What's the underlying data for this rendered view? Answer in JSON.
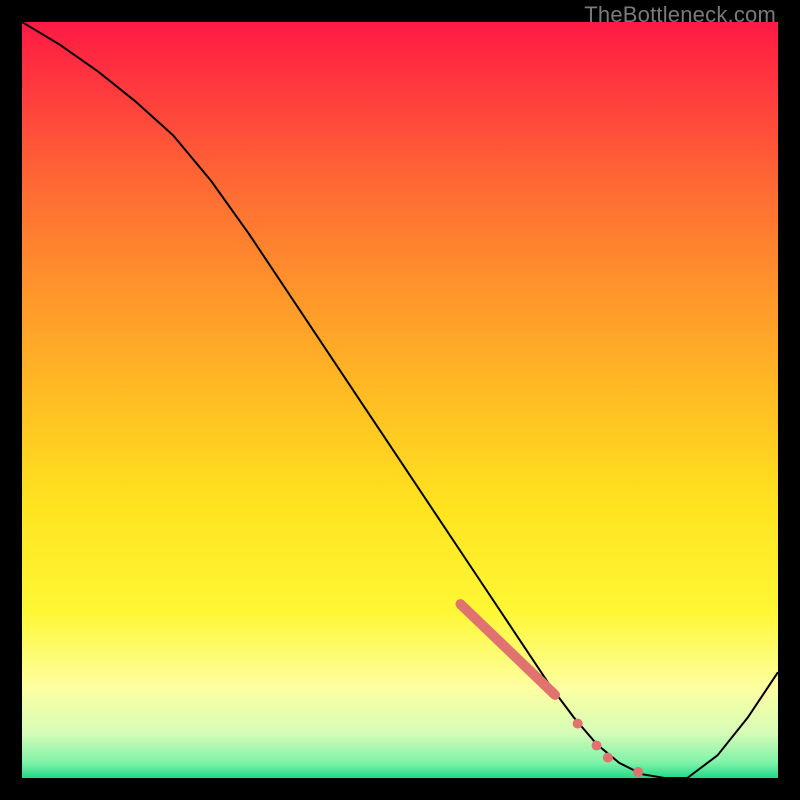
{
  "watermark": "TheBottleneck.com",
  "chart_data": {
    "type": "line",
    "title": "",
    "xlabel": "",
    "ylabel": "",
    "xlim": [
      0,
      100
    ],
    "ylim": [
      0,
      100
    ],
    "series": [
      {
        "name": "curve",
        "x": [
          0,
          5,
          10,
          15,
          20,
          25,
          30,
          35,
          40,
          45,
          50,
          55,
          60,
          65,
          70,
          73,
          76,
          79,
          82,
          85,
          88,
          92,
          96,
          100
        ],
        "y": [
          100,
          97,
          93.5,
          89.5,
          85,
          79,
          72,
          64.5,
          57,
          49.5,
          42,
          34.5,
          27,
          19.5,
          12,
          8,
          4.5,
          2,
          0.5,
          0,
          0,
          3,
          8,
          14
        ],
        "color": "#000000",
        "width": 2
      }
    ],
    "highlight_segment": {
      "x": [
        58,
        70.5
      ],
      "y": [
        23,
        11
      ],
      "color": "#e0736f",
      "width": 10
    },
    "highlight_dots": [
      {
        "x": 73.5,
        "y": 7.2,
        "r": 5,
        "color": "#e0736f"
      },
      {
        "x": 76.0,
        "y": 4.3,
        "r": 5,
        "color": "#e0736f"
      },
      {
        "x": 77.5,
        "y": 2.7,
        "r": 5,
        "color": "#e0736f"
      },
      {
        "x": 81.5,
        "y": 0.8,
        "r": 5,
        "color": "#e0736f"
      }
    ],
    "gradient_bands": [
      {
        "y0": 100,
        "y1": 91,
        "c0": "#ff1a44",
        "c1": "#ff3a3e"
      },
      {
        "y0": 91,
        "y1": 78,
        "c0": "#ff3a3e",
        "c1": "#ff6b33"
      },
      {
        "y0": 78,
        "y1": 64,
        "c0": "#ff6b33",
        "c1": "#ff962b"
      },
      {
        "y0": 64,
        "y1": 50,
        "c0": "#ff962b",
        "c1": "#ffbe23"
      },
      {
        "y0": 50,
        "y1": 36,
        "c0": "#ffbe23",
        "c1": "#ffe31f"
      },
      {
        "y0": 36,
        "y1": 22,
        "c0": "#ffe31f",
        "c1": "#fff735"
      },
      {
        "y0": 22,
        "y1": 12,
        "c0": "#fff735",
        "c1": "#fdffa0"
      },
      {
        "y0": 12,
        "y1": 6,
        "c0": "#fdffa0",
        "c1": "#d6fcb8"
      },
      {
        "y0": 6,
        "y1": 2,
        "c0": "#d6fcb8",
        "c1": "#7ef2a8"
      },
      {
        "y0": 2,
        "y1": 0,
        "c0": "#7ef2a8",
        "c1": "#22d888"
      }
    ]
  }
}
